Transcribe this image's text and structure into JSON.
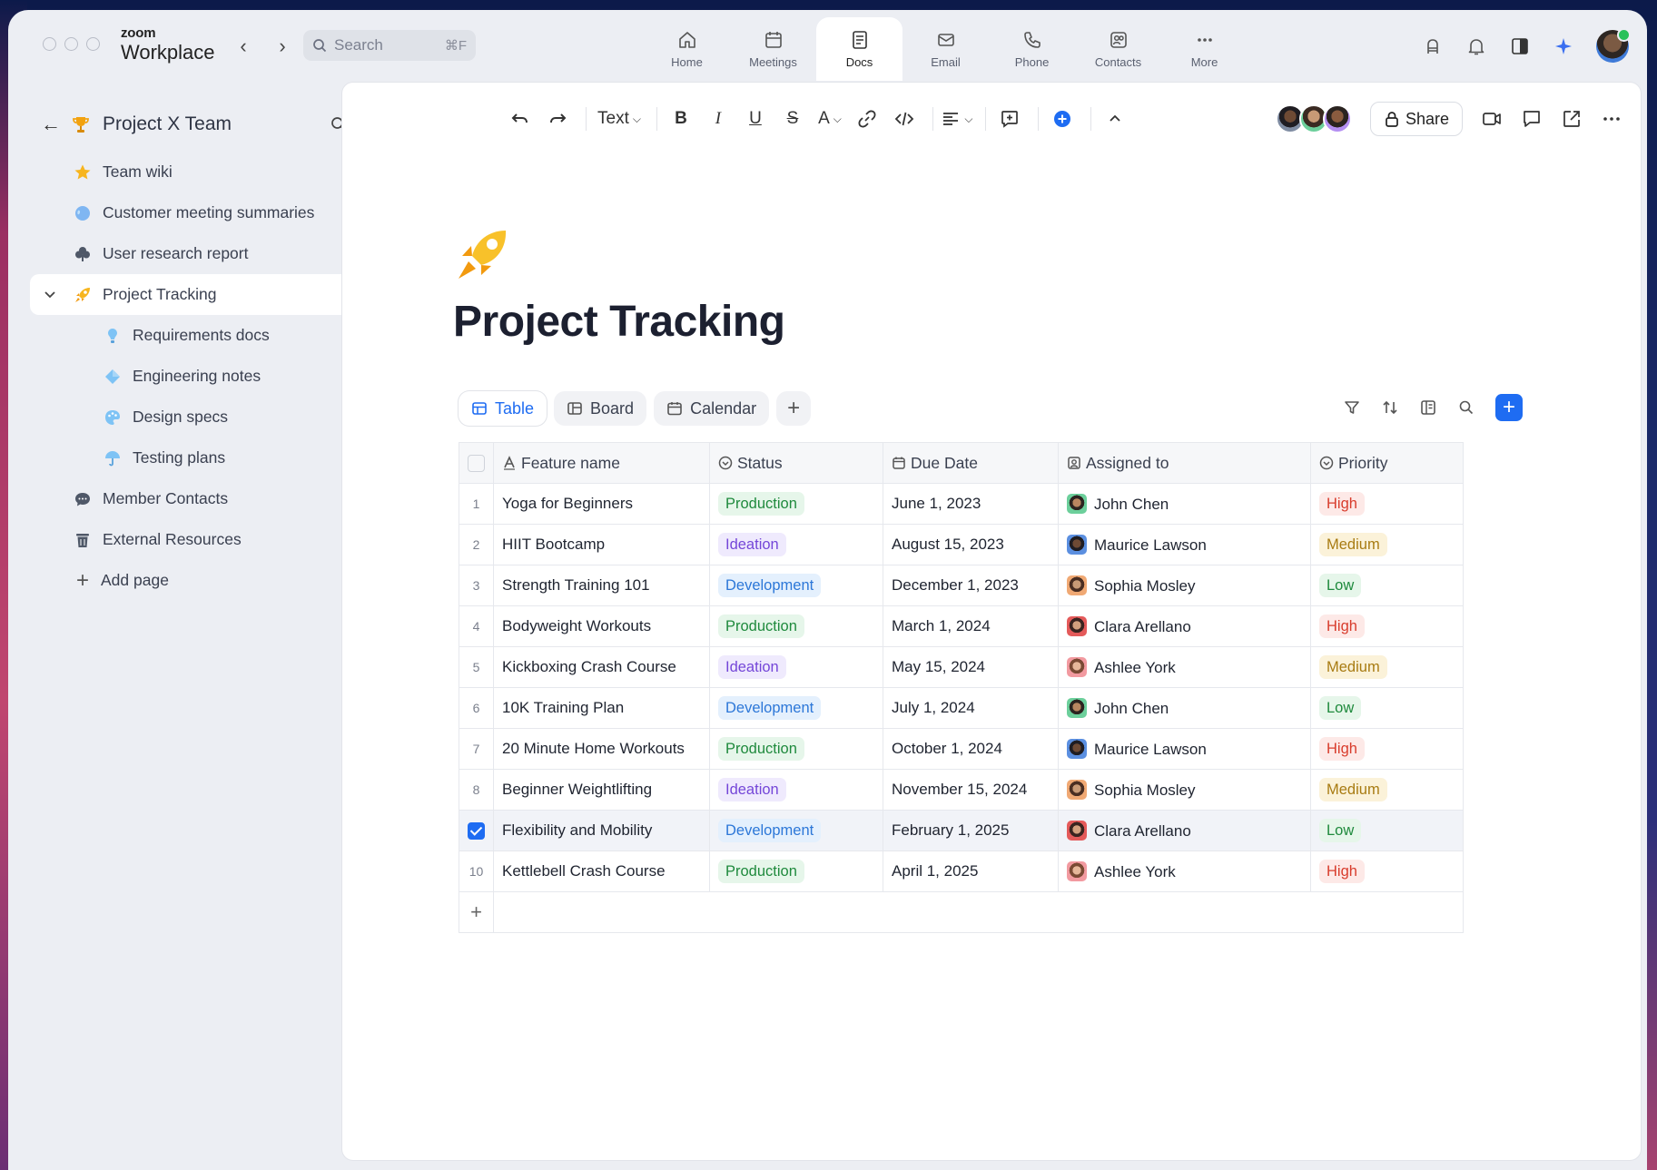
{
  "app": {
    "brand_top": "zoom",
    "brand_bottom": "Workplace",
    "search_placeholder": "Search",
    "search_shortcut": "⌘F",
    "nav_back": "‹",
    "nav_forward": "›"
  },
  "top_tabs": [
    {
      "label": "Home",
      "icon": "home-icon"
    },
    {
      "label": "Meetings",
      "icon": "calendar-icon"
    },
    {
      "label": "Docs",
      "icon": "doc-icon",
      "active": true
    },
    {
      "label": "Email",
      "icon": "email-icon"
    },
    {
      "label": "Phone",
      "icon": "phone-icon"
    },
    {
      "label": "Contacts",
      "icon": "contacts-icon"
    },
    {
      "label": "More",
      "icon": "more-icon"
    }
  ],
  "sidebar": {
    "back": "←",
    "title": "Project X Team",
    "items": [
      {
        "label": "Team wiki",
        "icon": "star-icon"
      },
      {
        "label": "Customer meeting summaries",
        "icon": "globe-icon"
      },
      {
        "label": "User research report",
        "icon": "clover-icon"
      },
      {
        "label": "Project Tracking",
        "icon": "rocket-icon",
        "active": true
      },
      {
        "label": "Requirements docs",
        "icon": "lightbulb-icon"
      },
      {
        "label": "Engineering notes",
        "icon": "diamond-icon"
      },
      {
        "label": "Design specs",
        "icon": "palette-icon"
      },
      {
        "label": "Testing plans",
        "icon": "umbrella-icon"
      },
      {
        "label": "Member Contacts",
        "icon": "chat-bubble-icon"
      },
      {
        "label": "External Resources",
        "icon": "trash-icon"
      },
      {
        "label": "Add page",
        "icon": "plus-icon"
      }
    ]
  },
  "toolbar": {
    "text_style": "Text",
    "bold": "B",
    "italic": "I",
    "underline": "U",
    "strike": "S",
    "font_color": "A",
    "share": "Share"
  },
  "doc": {
    "title": "Project Tracking",
    "views": [
      {
        "label": "Table",
        "active": true
      },
      {
        "label": "Board"
      },
      {
        "label": "Calendar"
      }
    ],
    "add_view": "+",
    "add_record": "+",
    "columns": [
      "Feature name",
      "Status",
      "Due Date",
      "Assigned to",
      "Priority"
    ],
    "rows": [
      {
        "num": "1",
        "feature": "Yoga for Beginners",
        "status": "Production",
        "due": "June 1, 2023",
        "assignee": "John Chen",
        "priority": "High"
      },
      {
        "num": "2",
        "feature": "HIIT Bootcamp",
        "status": "Ideation",
        "due": "August 15, 2023",
        "assignee": "Maurice Lawson",
        "priority": "Medium"
      },
      {
        "num": "3",
        "feature": "Strength Training 101",
        "status": "Development",
        "due": "December 1, 2023",
        "assignee": "Sophia Mosley",
        "priority": "Low"
      },
      {
        "num": "4",
        "feature": "Bodyweight Workouts",
        "status": "Production",
        "due": "March 1, 2024",
        "assignee": "Clara Arellano",
        "priority": "High"
      },
      {
        "num": "5",
        "feature": "Kickboxing Crash Course",
        "status": "Ideation",
        "due": "May 15, 2024",
        "assignee": "Ashlee York",
        "priority": "Medium"
      },
      {
        "num": "6",
        "feature": "10K Training Plan",
        "status": "Development",
        "due": "July 1, 2024",
        "assignee": "John Chen",
        "priority": "Low"
      },
      {
        "num": "7",
        "feature": "20 Minute Home Workouts",
        "status": "Production",
        "due": "October 1, 2024",
        "assignee": "Maurice Lawson",
        "priority": "High"
      },
      {
        "num": "8",
        "feature": "Beginner Weightlifting",
        "status": "Ideation",
        "due": "November 15, 2024",
        "assignee": "Sophia Mosley",
        "priority": "Medium"
      },
      {
        "num": "",
        "feature": "Flexibility and Mobility",
        "status": "Development",
        "due": "February 1, 2025",
        "assignee": "Clara Arellano",
        "priority": "Low",
        "selected": true
      },
      {
        "num": "10",
        "feature": "Kettlebell Crash Course",
        "status": "Production",
        "due": "April 1, 2025",
        "assignee": "Ashlee York",
        "priority": "High"
      }
    ]
  },
  "colors": {
    "accent": "#1e6cf2",
    "production": "#1f8a3d",
    "ideation": "#7446d8",
    "development": "#2c77d8",
    "high": "#d83c2c",
    "medium": "#a87b12",
    "low": "#1f8a3d"
  }
}
